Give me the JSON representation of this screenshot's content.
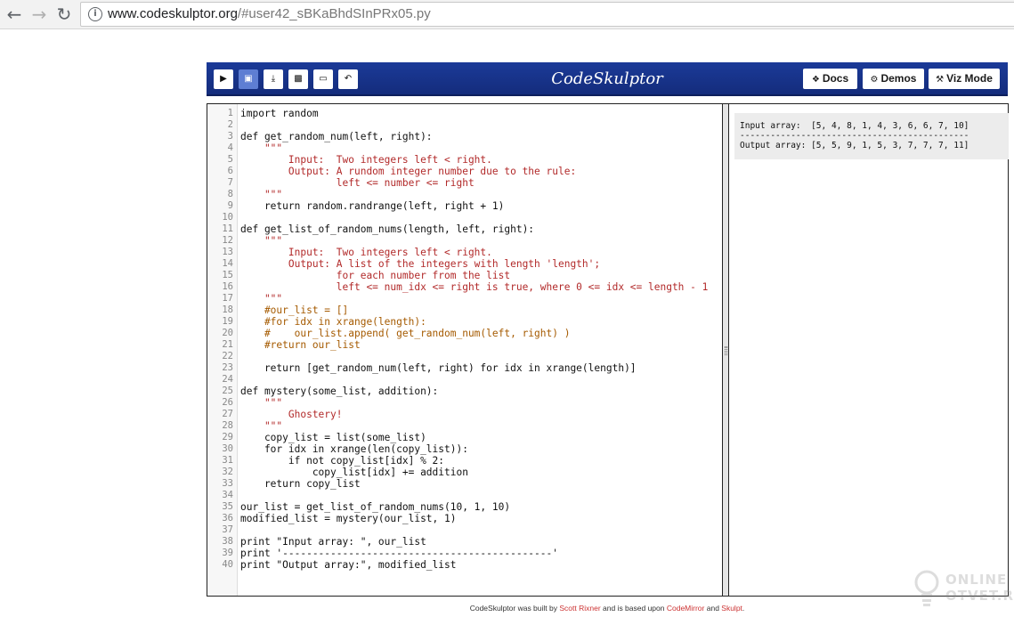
{
  "browser": {
    "back_icon": "arrow-left-icon",
    "forward_icon": "arrow-right-icon",
    "reload_icon": "reload-icon",
    "url_domain": "www.codeskulptor.org",
    "url_path": "/#user42_sBKaBhdSInPRx05.py"
  },
  "toolbar": {
    "title": "CodeSkulptor",
    "icon_buttons": [
      "run-icon",
      "save-icon",
      "download-icon",
      "lock-icon",
      "open-folder-icon",
      "reset-icon"
    ],
    "docs_label": "Docs",
    "demos_label": "Demos",
    "viz_label": "Viz Mode",
    "accent_color": "#1b3a98"
  },
  "editor": {
    "lines": [
      "import random",
      "",
      "def get_random_num(left, right):",
      "    \"\"\"",
      "        Input:  Two integers left < right.",
      "        Output: A rundom integer number due to the rule:",
      "                left <= number <= right",
      "    \"\"\"",
      "    return random.randrange(left, right + 1)",
      "",
      "def get_list_of_random_nums(length, left, right):",
      "    \"\"\"",
      "        Input:  Two integers left < right.",
      "        Output: A list of the integers with length 'length';",
      "                for each number from the list",
      "                left <= num_idx <= right is true, where 0 <= idx <= length - 1",
      "    \"\"\"",
      "    #our_list = []",
      "    #for idx in xrange(length):",
      "    #    our_list.append( get_random_num(left, right) )",
      "    #return our_list",
      "",
      "    return [get_random_num(left, right) for idx in xrange(length)]",
      "",
      "def mystery(some_list, addition):",
      "    \"\"\"",
      "        Ghostery!",
      "    \"\"\"",
      "    copy_list = list(some_list)",
      "    for idx in xrange(len(copy_list)):",
      "        if not copy_list[idx] % 2:",
      "            copy_list[idx] += addition",
      "    return copy_list",
      "",
      "our_list = get_list_of_random_nums(10, 1, 10)",
      "modified_list = mystery(our_list, 1)",
      "",
      "print \"Input array: \", our_list",
      "print '---------------------------------------------'",
      "print \"Output array:\", modified_list"
    ]
  },
  "output": {
    "lines": [
      "Input array:  [5, 4, 8, 1, 4, 3, 6, 6, 7, 10]",
      "---------------------------------------------",
      "Output array: [5, 5, 9, 1, 5, 3, 7, 7, 7, 11]"
    ]
  },
  "footer": {
    "prefix": "CodeSkulptor was built by ",
    "author": "Scott Rixner",
    "middle": " and is based upon ",
    "lib1": "CodeMirror",
    "and": " and ",
    "lib2": "Skulpt",
    "suffix": "."
  },
  "watermark": {
    "line1": "ONLINE",
    "line2": "OTVET.RU"
  }
}
